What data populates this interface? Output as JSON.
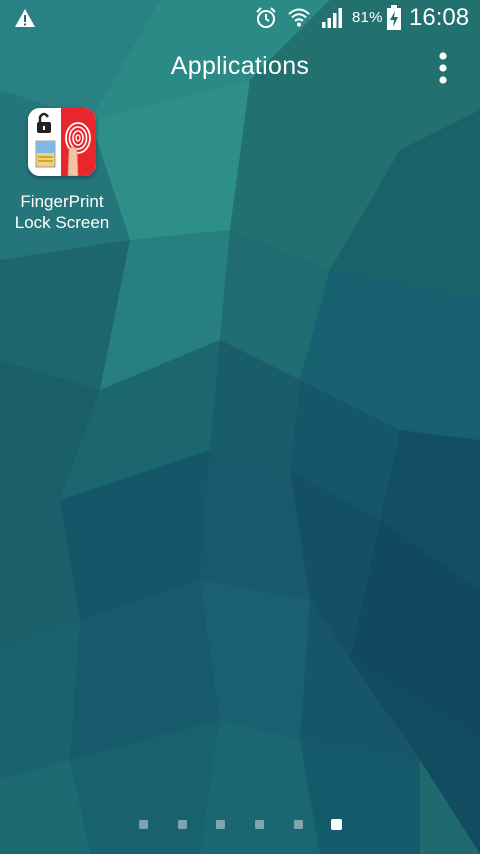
{
  "status_bar": {
    "battery_percent": "81%",
    "time": "16:08",
    "icons": [
      "warning-icon",
      "alarm-icon",
      "wifi-icon",
      "signal-icon",
      "battery-charging-icon"
    ]
  },
  "header": {
    "title": "Applications",
    "menu_icon": "more-vertical-icon"
  },
  "apps": [
    {
      "label": "FingerPrint Lock Screen",
      "icon": "fingerprint-lock-app-icon"
    }
  ],
  "pagination": {
    "pages": 6,
    "active_index": 5
  },
  "colors": {
    "wallpaper_base": "#1f6b6f",
    "wallpaper_dark": "#164c58",
    "app_icon_red": "#e8262b"
  }
}
